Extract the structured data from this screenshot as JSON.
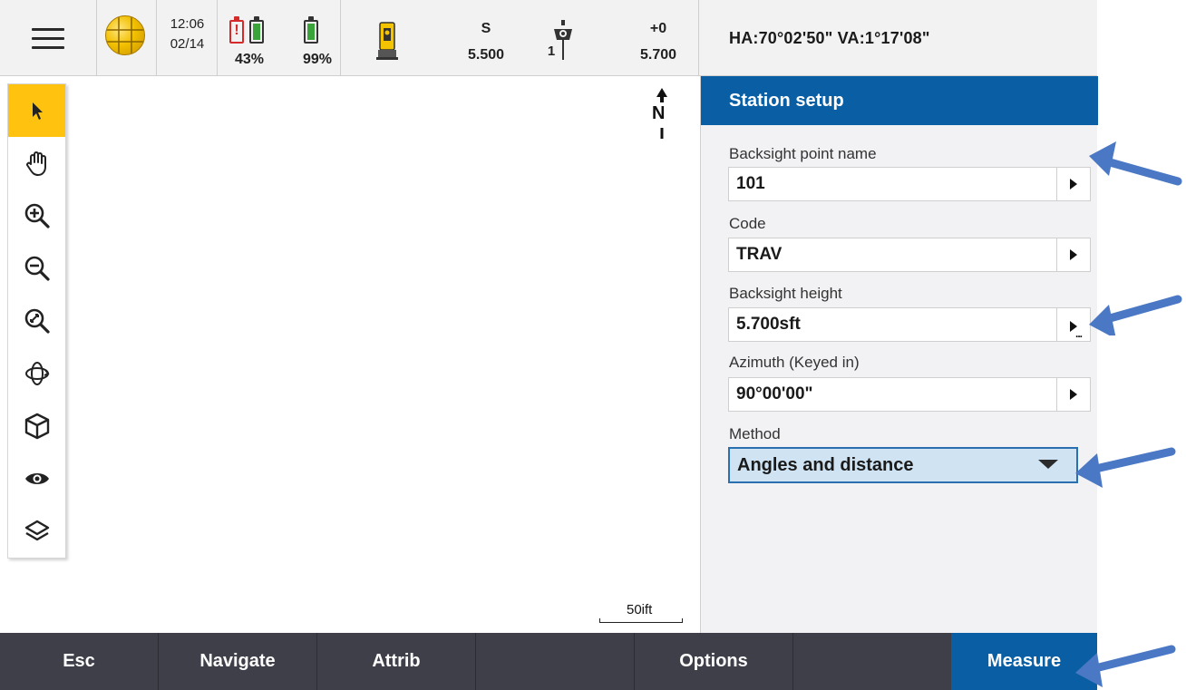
{
  "status_bar": {
    "time": "12:06",
    "date": "02/14",
    "battery_1_percent": "43%",
    "battery_2_percent": "99%",
    "instrument_mode": "S",
    "instrument_value": "5.500",
    "target_number": "1",
    "target_offset": "+0",
    "target_height": "5.700",
    "angles": "HA:70°02'50\"  VA:1°17'08\""
  },
  "map": {
    "north_label": "N",
    "scale_label": "50ift"
  },
  "toolbar": {
    "tools": [
      "select-tool",
      "pan-tool",
      "zoom-in-tool",
      "zoom-out-tool",
      "zoom-extents-tool",
      "orbit-tool",
      "3d-view-tool",
      "visibility-tool",
      "layers-tool"
    ],
    "active": "select-tool"
  },
  "panel": {
    "title": "Station setup",
    "fields": [
      {
        "label": "Backsight point name",
        "value": "101"
      },
      {
        "label": "Code",
        "value": "TRAV"
      },
      {
        "label": "Backsight height",
        "value": "5.700sft"
      },
      {
        "label": "Azimuth (Keyed in)",
        "value": "90°00'00\""
      }
    ],
    "method": {
      "label": "Method",
      "value": "Angles and distance"
    }
  },
  "softkeys": [
    "Esc",
    "Navigate",
    "Attrib",
    "",
    "Options",
    "",
    "Measure"
  ],
  "colors": {
    "accent_blue": "#0a5fa4",
    "active_tool": "#ffc20e",
    "softkey_bg": "#3f3f4a",
    "annotation_arrow": "#4a78c4",
    "battery_warning": "#d62a2a",
    "battery_ok": "#3aa33a"
  }
}
